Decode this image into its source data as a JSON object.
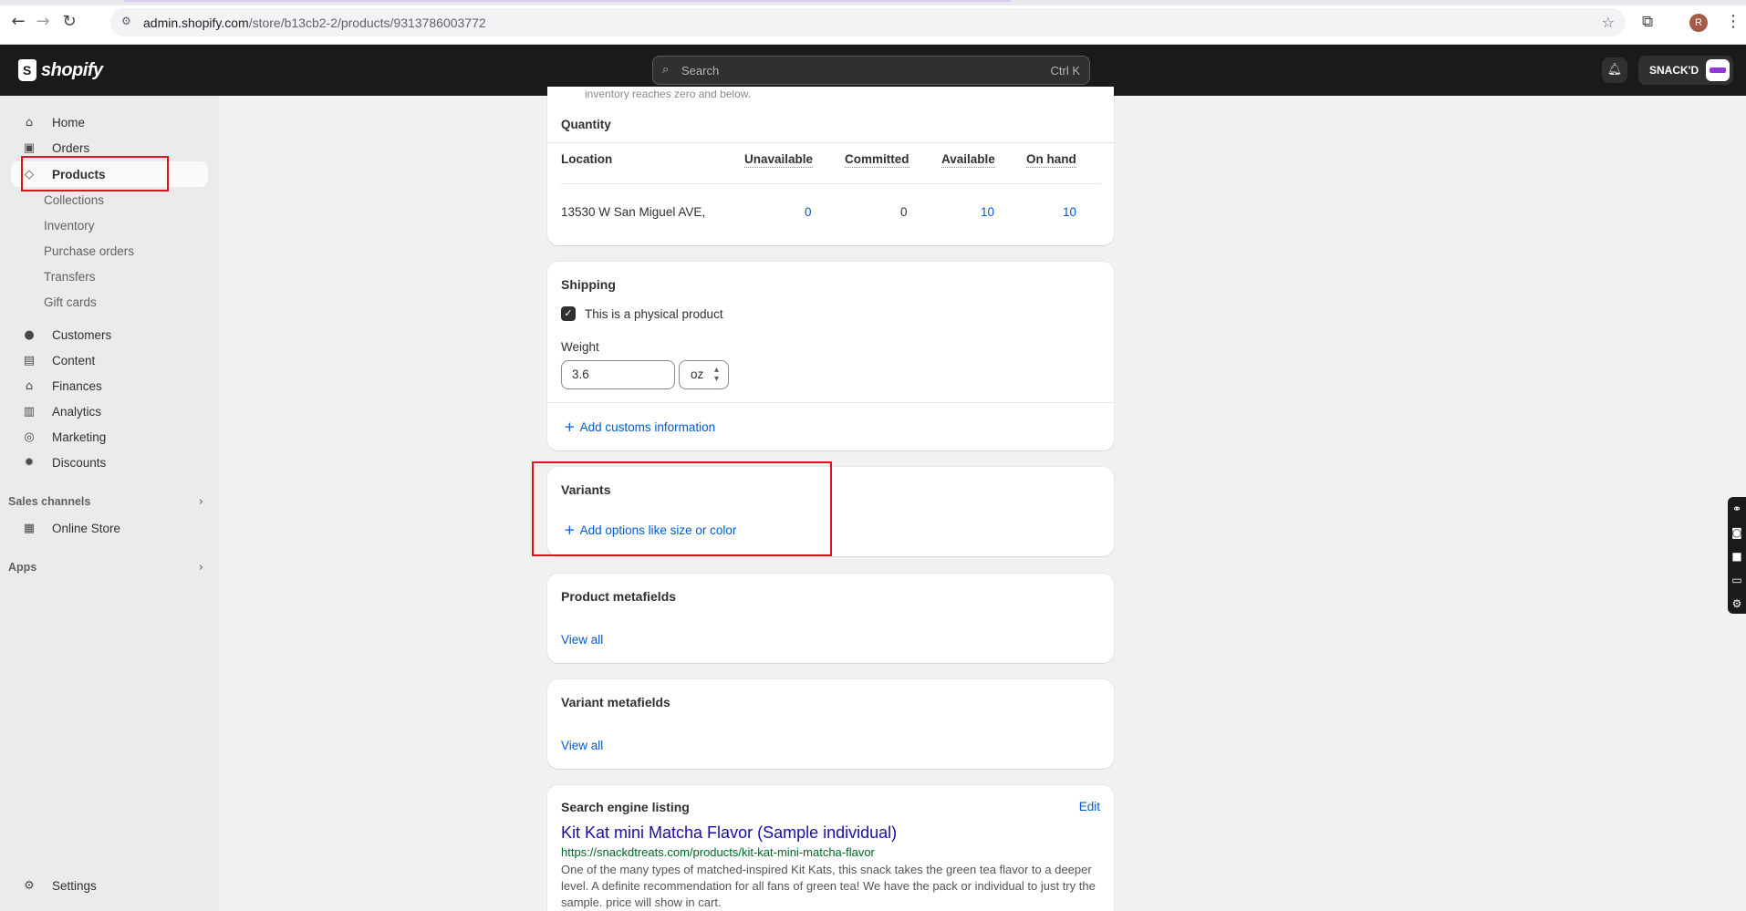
{
  "browser": {
    "url_host": "admin.shopify.com",
    "url_path": "/store/b13cb2-2/products/9313786003772",
    "avatar_letter": "R"
  },
  "topbar": {
    "logo_text": "shopify",
    "search_placeholder": "Search",
    "search_shortcut": "Ctrl K",
    "store_name": "SNACK'D"
  },
  "sidebar": {
    "home": "Home",
    "orders": "Orders",
    "products": "Products",
    "product_subs": [
      "Collections",
      "Inventory",
      "Purchase orders",
      "Transfers",
      "Gift cards"
    ],
    "customers": "Customers",
    "content": "Content",
    "finances": "Finances",
    "analytics": "Analytics",
    "marketing": "Marketing",
    "discounts": "Discounts",
    "sales_channels": "Sales channels",
    "online_store": "Online Store",
    "apps": "Apps",
    "settings": "Settings"
  },
  "inventory": {
    "cut_text": "inventory reaches zero and below.",
    "quantity_title": "Quantity",
    "headers": {
      "location": "Location",
      "unavailable": "Unavailable",
      "committed": "Committed",
      "available": "Available",
      "on_hand": "On hand"
    },
    "row": {
      "location": "13530 W San Miguel AVE,",
      "unavailable": "0",
      "committed": "0",
      "available": "10",
      "on_hand": "10"
    }
  },
  "shipping": {
    "title": "Shipping",
    "physical_label": "This is a physical product",
    "physical_checked": true,
    "weight_label": "Weight",
    "weight_value": "3.6",
    "weight_unit": "oz",
    "customs_link": "Add customs information"
  },
  "variants": {
    "title": "Variants",
    "add_options": "Add options like size or color"
  },
  "product_metafields": {
    "title": "Product metafields",
    "view_all": "View all"
  },
  "variant_metafields": {
    "title": "Variant metafields",
    "view_all": "View all"
  },
  "seo": {
    "title": "Search engine listing",
    "edit": "Edit",
    "page_title": "Kit Kat mini Matcha Flavor (Sample individual)",
    "url": "https://snackdtreats.com/products/kit-kat-mini-matcha-flavor",
    "description": "One of the many types of matched-inspired Kit Kats, this snack takes the green tea flavor to a deeper level. A definite recommendation for all fans of green tea! We have the pack or individual to just try the sample. price will show in cart."
  },
  "colors": {
    "accent_link": "#005bd3",
    "highlight": "#e0121d",
    "seo_title": "#1a0dab",
    "seo_url": "#006621"
  }
}
